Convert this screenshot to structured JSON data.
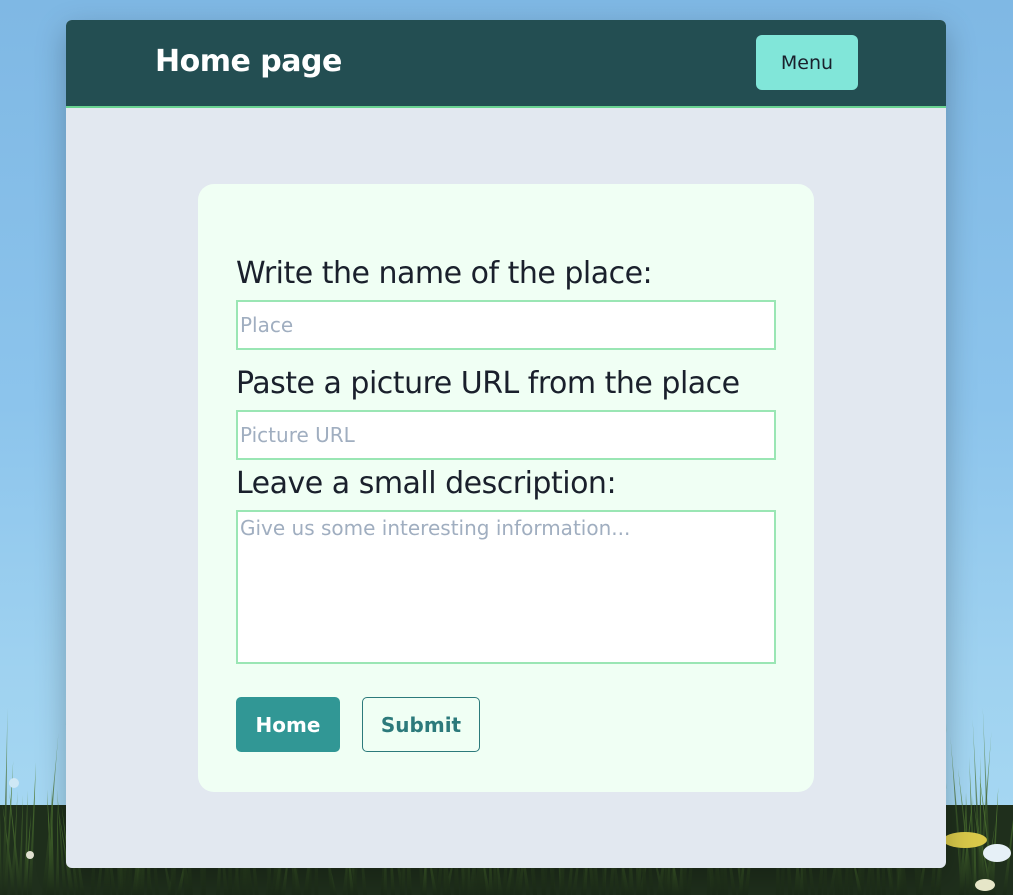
{
  "header": {
    "title": "Home page",
    "menu_label": "Menu"
  },
  "form": {
    "place_label": "Write the name of the place:",
    "place_placeholder": "Place",
    "place_value": "",
    "picture_label": "Paste a picture URL from the place",
    "picture_placeholder": "Picture URL",
    "picture_value": "",
    "description_label": "Leave a small description:",
    "description_placeholder": "Give us some interesting information...",
    "description_value": "",
    "home_button": "Home",
    "submit_button": "Submit"
  },
  "colors": {
    "header_bg": "#234e52",
    "menu_button": "#81e6d9",
    "form_bg": "#f0fff4",
    "input_border": "#9ae6b4",
    "home_button": "#319795",
    "submit_border": "#2c7a7b"
  }
}
